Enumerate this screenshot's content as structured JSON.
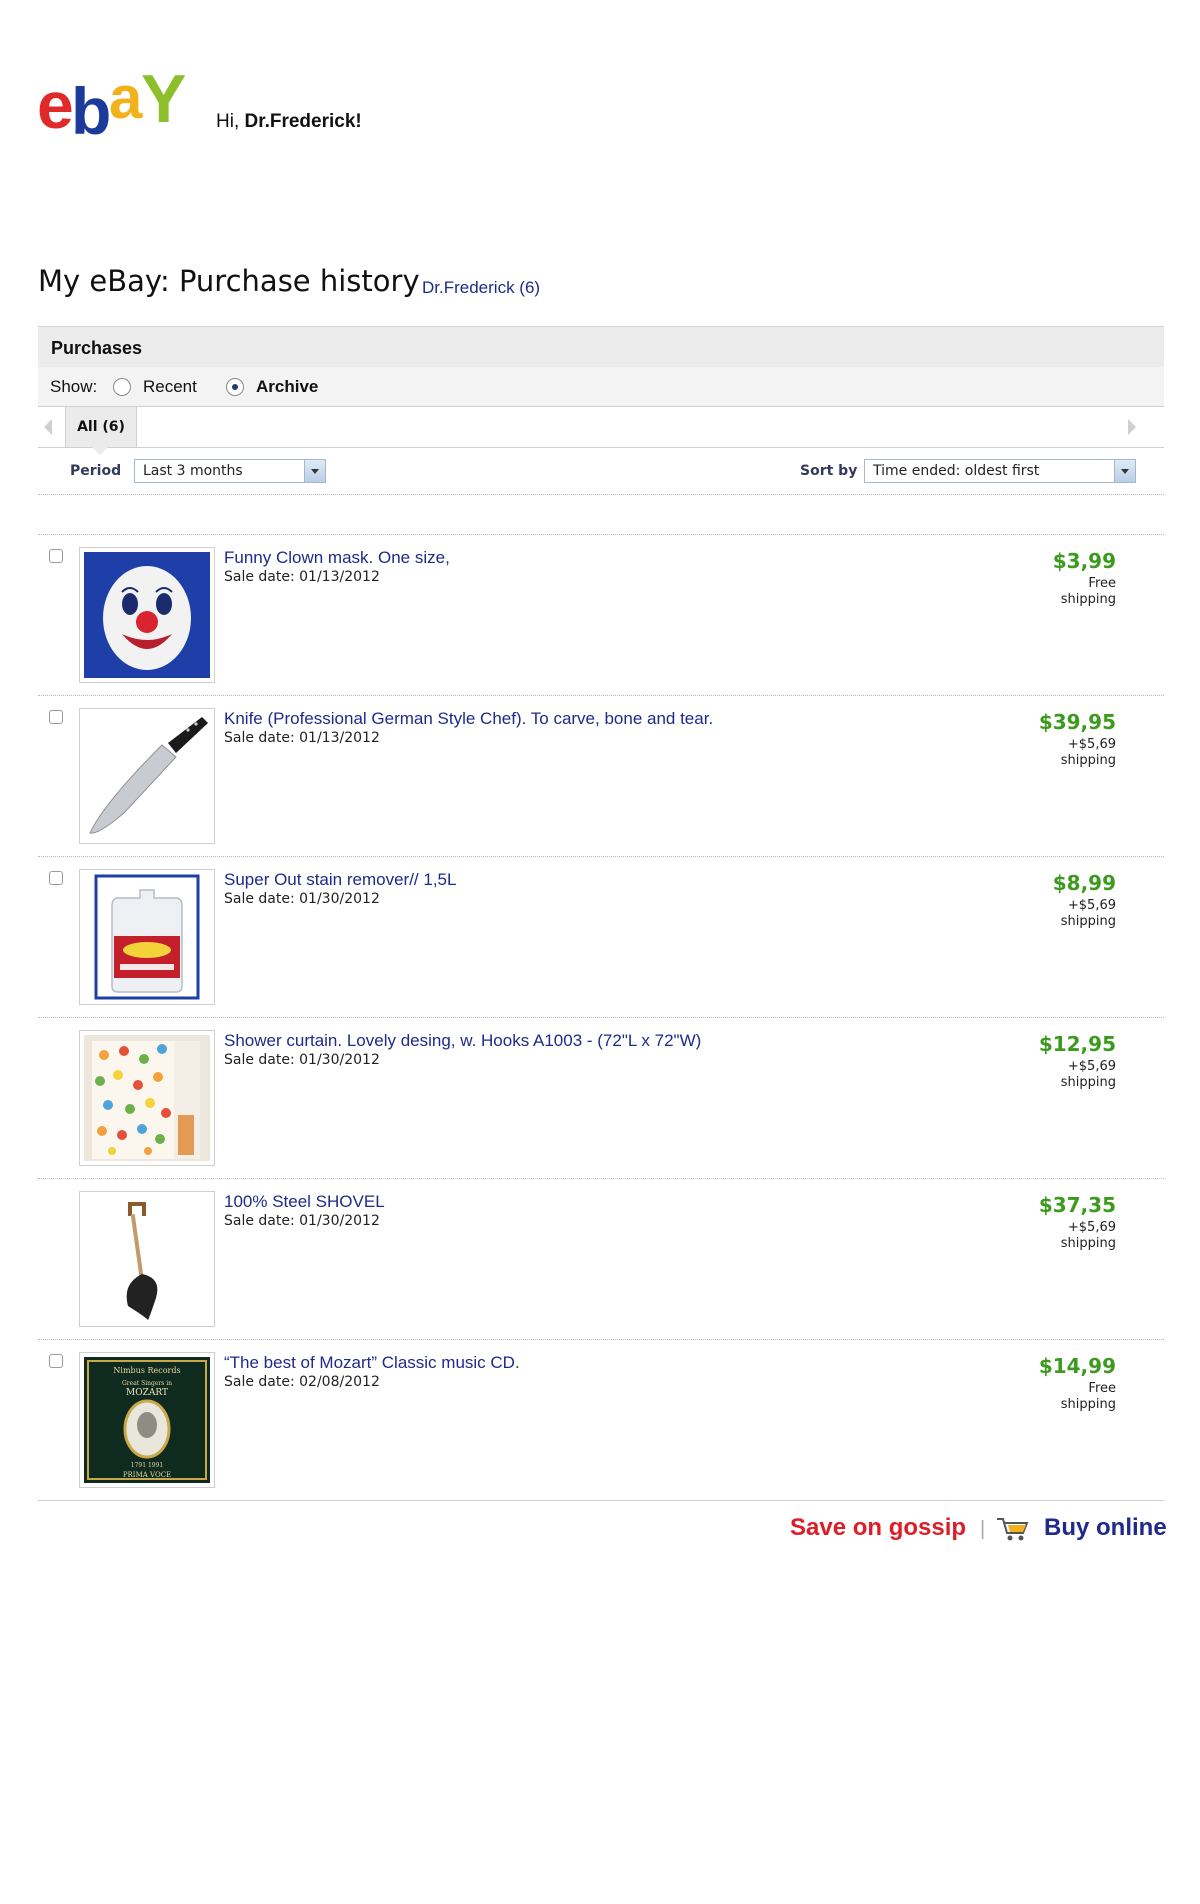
{
  "header": {
    "logo_text": "ebay",
    "greeting_prefix": "Hi, ",
    "username": "Dr.Frederick!"
  },
  "page": {
    "title": "My eBay: Purchase history",
    "user_link": "Dr.Frederick (6)"
  },
  "purchases": {
    "section_title": "Purchases",
    "show_label": "Show:",
    "options": [
      {
        "label": "Recent",
        "selected": false
      },
      {
        "label": "Archive",
        "selected": true
      }
    ],
    "tab_label": "All (6)",
    "period_label": "Period",
    "period_value": "Last 3 months",
    "sort_label": "Sort by",
    "sort_value": "Time ended: oldest first"
  },
  "items": [
    {
      "title": "Funny Clown mask. One size,",
      "sale_date": "Sale date: 01/13/2012",
      "price": "$3,99",
      "shipping_line1": "Free",
      "shipping_line2": "shipping",
      "has_checkbox": true,
      "image": "clown-mask-icon"
    },
    {
      "title": "Knife (Professional German Style Chef). To carve, bone and tear.",
      "sale_date": "Sale date: 01/13/2012",
      "price": "$39,95",
      "shipping_line1": "+$5,69",
      "shipping_line2": "shipping",
      "has_checkbox": true,
      "image": "knife-icon"
    },
    {
      "title": "Super Out stain remover// 1,5L",
      "sale_date": "Sale date: 01/30/2012",
      "price": "$8,99",
      "shipping_line1": "+$5,69",
      "shipping_line2": "shipping",
      "has_checkbox": true,
      "image": "jug-icon"
    },
    {
      "title": "Shower curtain. Lovely desing, w. Hooks  A1003 - (72\"L x 72\"W)",
      "sale_date": "Sale date: 01/30/2012",
      "price": "$12,95",
      "shipping_line1": "+$5,69",
      "shipping_line2": "shipping",
      "has_checkbox": false,
      "image": "shower-curtain-icon"
    },
    {
      "title": "100% Steel SHOVEL",
      "sale_date": "Sale date: 01/30/2012",
      "price": "$37,35",
      "shipping_line1": "+$5,69",
      "shipping_line2": "shipping",
      "has_checkbox": false,
      "image": "shovel-icon"
    },
    {
      "title": "“The best of Mozart” Classic music CD.",
      "sale_date": "Sale date: 02/08/2012",
      "price": "$14,99",
      "shipping_line1": "Free",
      "shipping_line2": "shipping",
      "has_checkbox": true,
      "image": "mozart-cd-icon",
      "cd_text": {
        "label": "Nimbus Records",
        "subtitle": "Great Singers in",
        "name": "MOZART",
        "years": "1791 1991",
        "series": "PRIMA VOCE"
      }
    }
  ],
  "footer": {
    "save_text": "Save on gossip",
    "separator": "|",
    "buy_text": "Buy online",
    "icon": "shopping-cart-icon"
  },
  "colors": {
    "link_blue": "#1f2a8a",
    "price_green": "#3c9a1e",
    "footer_red": "#dd1e2a"
  }
}
